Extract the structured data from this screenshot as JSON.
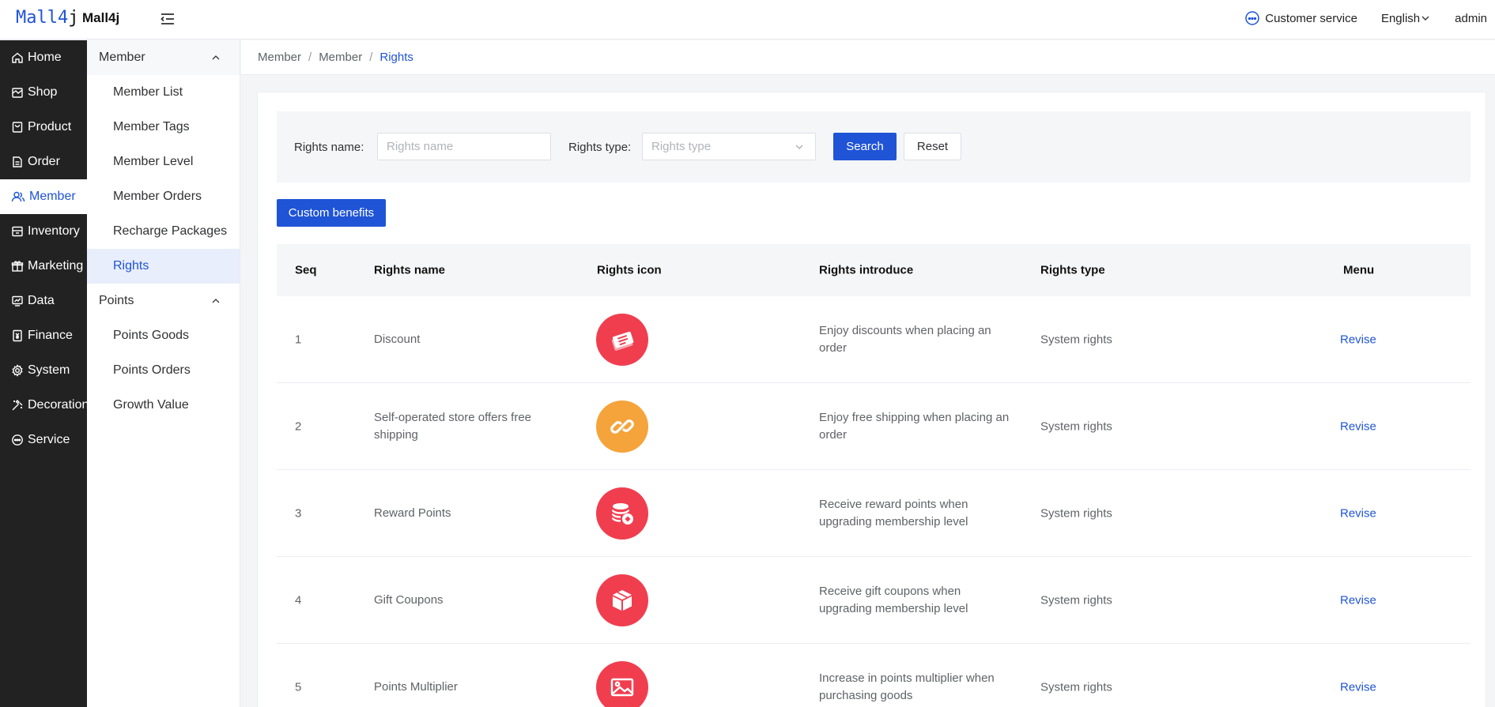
{
  "header": {
    "logo_main": "Mall4",
    "logo_accent": "j",
    "brand": "Mall4j",
    "customer_service": "Customer service",
    "language": "English",
    "user": "admin"
  },
  "nav": {
    "items": [
      {
        "label": "Home",
        "icon": "home-icon"
      },
      {
        "label": "Shop",
        "icon": "shop-icon"
      },
      {
        "label": "Product",
        "icon": "product-icon"
      },
      {
        "label": "Order",
        "icon": "order-icon"
      },
      {
        "label": "Member",
        "icon": "member-icon"
      },
      {
        "label": "Inventory",
        "icon": "inventory-icon"
      },
      {
        "label": "Marketing",
        "icon": "marketing-icon"
      },
      {
        "label": "Data",
        "icon": "data-icon"
      },
      {
        "label": "Finance",
        "icon": "finance-icon"
      },
      {
        "label": "System",
        "icon": "system-icon"
      },
      {
        "label": "Decoration",
        "icon": "decoration-icon"
      },
      {
        "label": "Service",
        "icon": "service-icon"
      }
    ]
  },
  "subnav": {
    "member_group": "Member",
    "member_items": [
      "Member List",
      "Member Tags",
      "Member Level",
      "Member Orders",
      "Recharge Packages",
      "Rights"
    ],
    "points_group": "Points",
    "points_items": [
      "Points Goods",
      "Points Orders",
      "Growth Value"
    ]
  },
  "breadcrumb": [
    "Member",
    "Member",
    "Rights"
  ],
  "breadcrumb_sep": "/",
  "filter": {
    "name_label": "Rights name:",
    "name_placeholder": "Rights name",
    "type_label": "Rights type:",
    "type_placeholder": "Rights type",
    "search": "Search",
    "reset": "Reset"
  },
  "custom_button": "Custom benefits",
  "table": {
    "headers": {
      "seq": "Seq",
      "name": "Rights name",
      "icon": "Rights icon",
      "intro": "Rights introduce",
      "type": "Rights type",
      "menu": "Menu"
    },
    "rows": [
      {
        "seq": "1",
        "name": "Discount",
        "icon": "ticket-icon",
        "icon_color": "#f03e4f",
        "intro": "Enjoy discounts when placing an order",
        "type": "System rights",
        "action": "Revise"
      },
      {
        "seq": "2",
        "name": "Self-operated store offers free shipping",
        "icon": "link-icon",
        "icon_color": "#f5a33b",
        "intro": "Enjoy free shipping when placing an order",
        "type": "System rights",
        "action": "Revise"
      },
      {
        "seq": "3",
        "name": "Reward Points",
        "icon": "coins-icon",
        "icon_color": "#f03e4f",
        "intro": "Receive reward points when upgrading membership level",
        "type": "System rights",
        "action": "Revise"
      },
      {
        "seq": "4",
        "name": "Gift Coupons",
        "icon": "gift-box-icon",
        "icon_color": "#f03e4f",
        "intro": "Receive gift coupons when upgrading membership level",
        "type": "System rights",
        "action": "Revise"
      },
      {
        "seq": "5",
        "name": "Points Multiplier",
        "icon": "image-icon",
        "icon_color": "#f03e4f",
        "intro": "Increase in points multiplier when purchasing goods",
        "type": "System rights",
        "action": "Revise"
      }
    ]
  }
}
